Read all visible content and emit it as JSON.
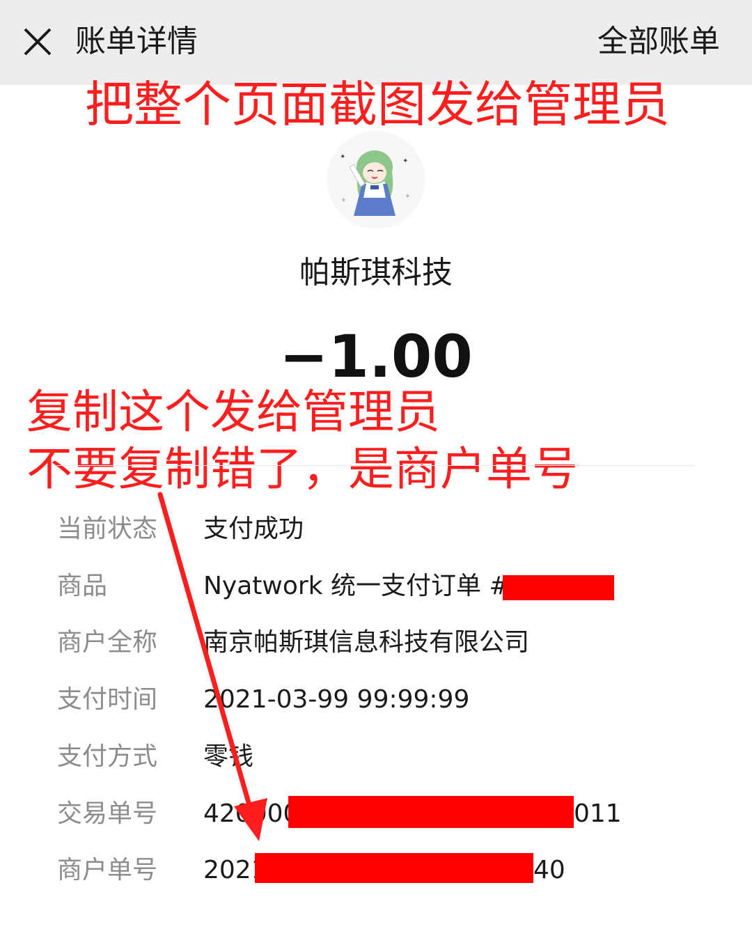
{
  "header": {
    "title": "账单详情",
    "all_bills": "全部账单",
    "bg_color": "#ededed"
  },
  "annotations": {
    "top": "把整个页面截图发给管理员",
    "copy_line1": "复制这个发给管理员",
    "copy_line2": "不要复制错了，是商户单号",
    "color": "#ff1e1e"
  },
  "merchant": {
    "name": "帕斯琪科技"
  },
  "amount": "−1.00",
  "details": {
    "status_label": "当前状态",
    "status_value": "支付成功",
    "product_label": "商品",
    "product_value": "Nyatwork 统一支付订单 #",
    "merchant_full_label": "商户全称",
    "merchant_full_value": "南京帕斯琪信息科技有限公司",
    "pay_time_label": "支付时间",
    "pay_time_value": "2021-03-99 99:99:99",
    "pay_method_label": "支付方式",
    "pay_method_value": "零钱",
    "transaction_no_label": "交易单号",
    "transaction_no_prefix": "420000",
    "transaction_no_suffix": "011",
    "merchant_no_label": "商户单号",
    "merchant_no_prefix": "2021",
    "merchant_no_suffix": "40"
  },
  "redaction_color": "#ff0000"
}
